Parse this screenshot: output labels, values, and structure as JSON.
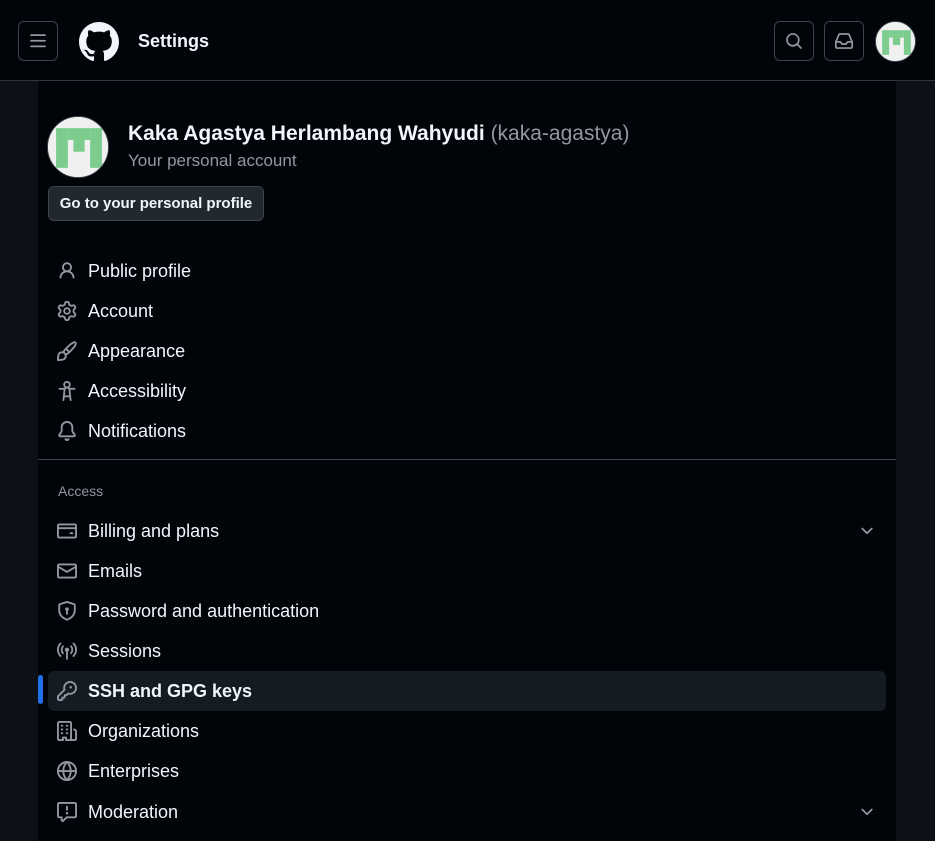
{
  "header": {
    "title": "Settings",
    "menu_icon": "hamburger-icon",
    "logo_icon": "github-mark-icon",
    "search_icon": "search-icon",
    "inbox_icon": "inbox-icon"
  },
  "profile": {
    "name": "Kaka Agastya Herlambang Wahyudi",
    "handle": "(kaka-agastya)",
    "subtitle": "Your personal account",
    "go_to_profile_label": "Go to your personal profile"
  },
  "nav": {
    "items": [
      {
        "label": "Public profile",
        "icon": "person-icon"
      },
      {
        "label": "Account",
        "icon": "gear-icon"
      },
      {
        "label": "Appearance",
        "icon": "paintbrush-icon"
      },
      {
        "label": "Accessibility",
        "icon": "accessibility-icon"
      },
      {
        "label": "Notifications",
        "icon": "bell-icon"
      }
    ],
    "access_heading": "Access",
    "access_items": [
      {
        "label": "Billing and plans",
        "icon": "credit-card-icon",
        "expandable": true
      },
      {
        "label": "Emails",
        "icon": "mail-icon"
      },
      {
        "label": "Password and authentication",
        "icon": "shield-lock-icon"
      },
      {
        "label": "Sessions",
        "icon": "broadcast-icon"
      },
      {
        "label": "SSH and GPG keys",
        "icon": "key-icon",
        "active": true
      },
      {
        "label": "Organizations",
        "icon": "organization-icon"
      },
      {
        "label": "Enterprises",
        "icon": "globe-icon"
      },
      {
        "label": "Moderation",
        "icon": "report-icon",
        "expandable": true
      }
    ]
  },
  "colors": {
    "background": "#0d1117",
    "panel": "#010409",
    "accent": "#1f6feb",
    "avatar_green": "#7ccc8e"
  }
}
